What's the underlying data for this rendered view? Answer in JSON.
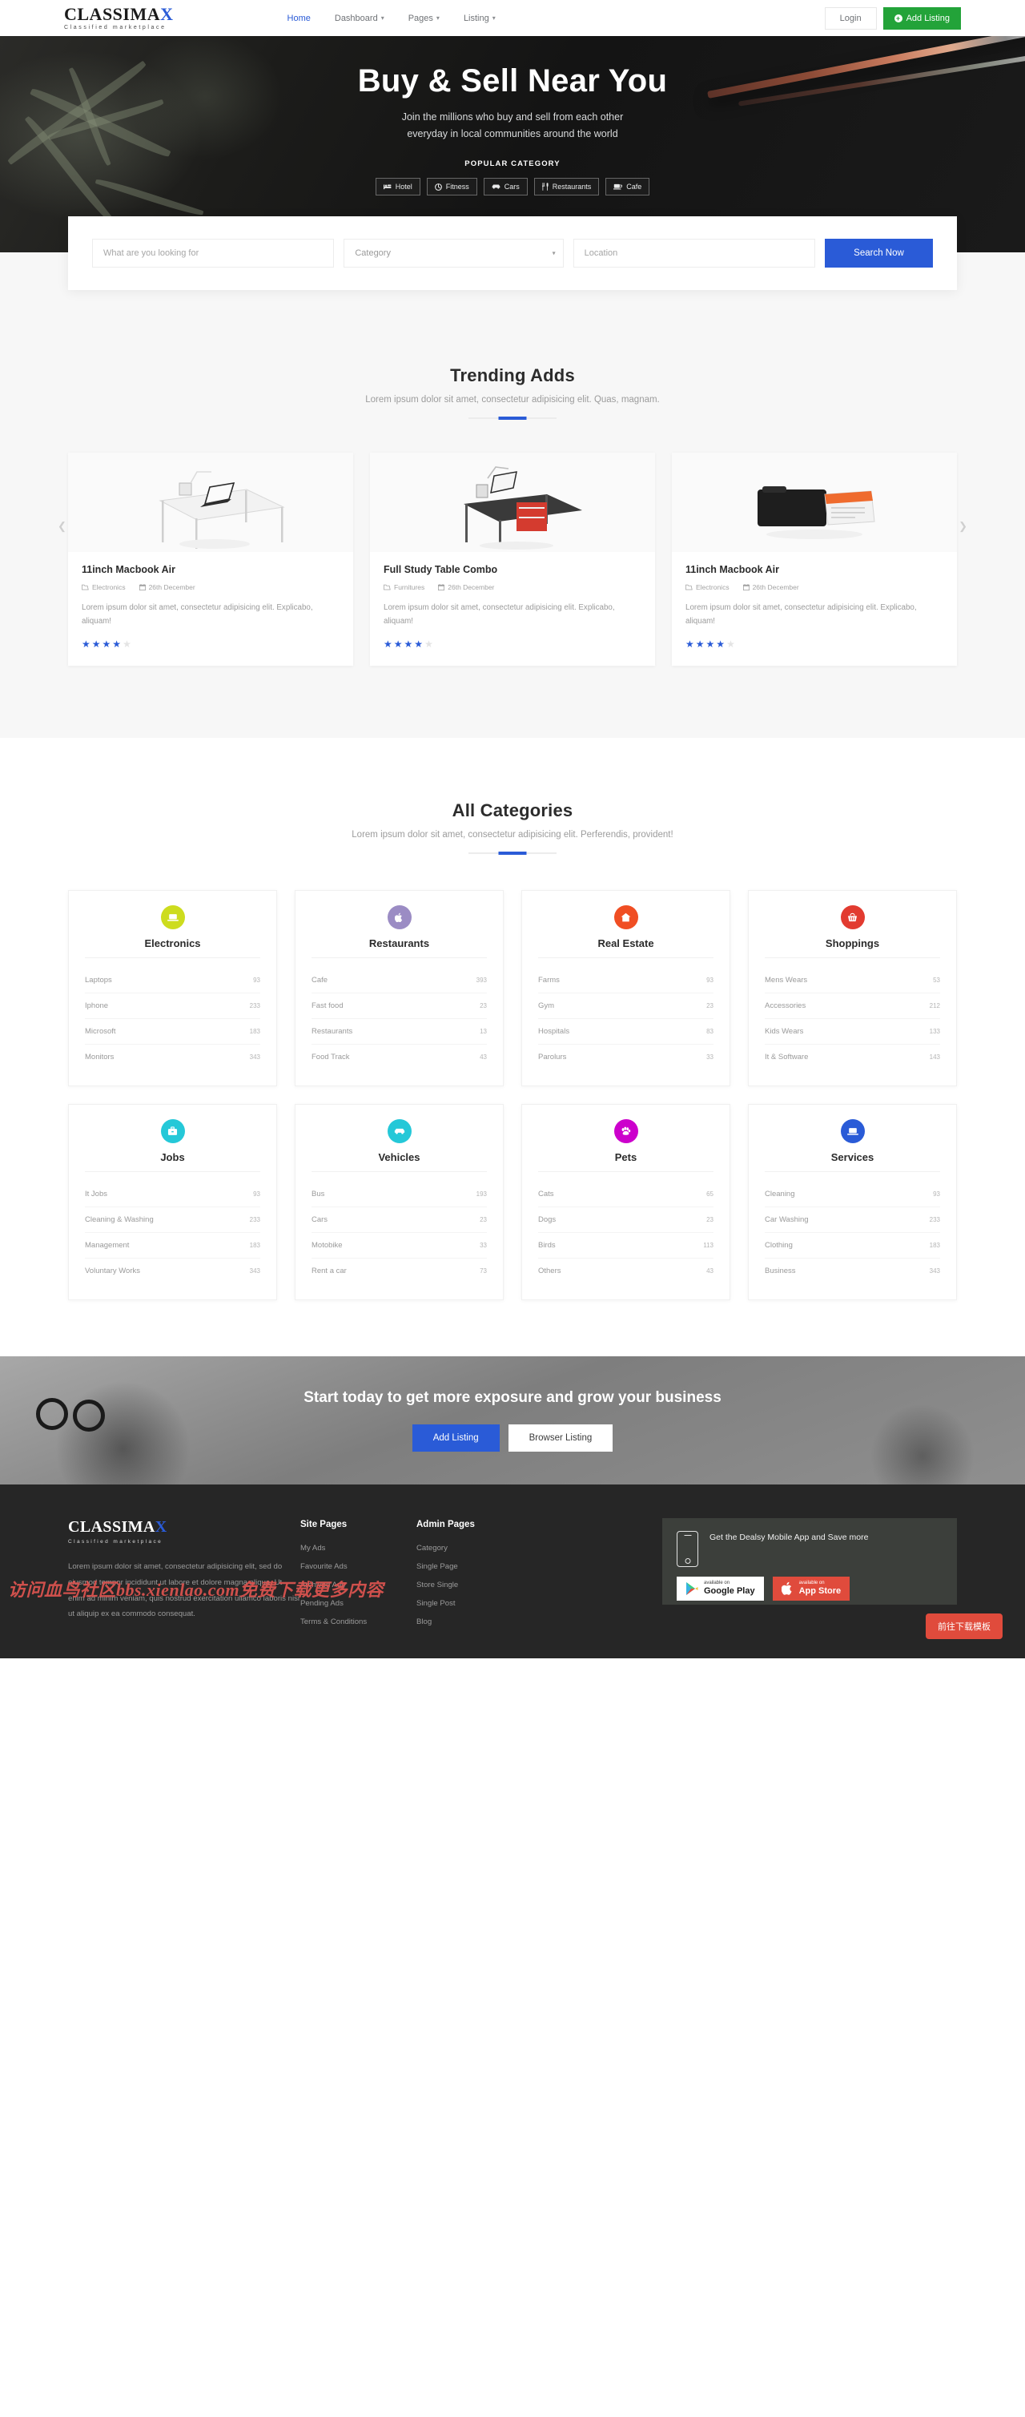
{
  "brand": {
    "name_main": "CLASSIMA",
    "name_accent": "X",
    "tagline": "Classified marketplace"
  },
  "header": {
    "nav": [
      {
        "label": "Home",
        "caret": "",
        "active": true
      },
      {
        "label": "Dashboard",
        "caret": "⌄",
        "active": false
      },
      {
        "label": "Pages",
        "caret": "⌄",
        "active": false
      },
      {
        "label": "Listing",
        "caret": "⌄",
        "active": false
      }
    ],
    "login_label": "Login",
    "add_listing_label": "Add Listing",
    "add_listing_plus": "+"
  },
  "hero": {
    "title": "Buy & Sell Near You",
    "subtitle_line1": "Join the millions who buy and sell from each other",
    "subtitle_line2": "everyday in local communities around the world",
    "popular_label": "POPULAR CATEGORY",
    "chips": [
      {
        "label": "Hotel",
        "icon": "bed-icon"
      },
      {
        "label": "Fitness",
        "icon": "fitness-icon"
      },
      {
        "label": "Cars",
        "icon": "car-icon"
      },
      {
        "label": "Restaurants",
        "icon": "cutlery-icon"
      },
      {
        "label": "Cafe",
        "icon": "coffee-icon"
      }
    ]
  },
  "search": {
    "keyword_placeholder": "What are you looking for",
    "category_value": "Category",
    "location_placeholder": "Location",
    "button_label": "Search Now"
  },
  "trending": {
    "title": "Trending Adds",
    "subtitle": "Lorem ipsum dolor sit amet, consectetur adipisicing elit. Quas, magnam.",
    "cards": [
      {
        "title": "11inch Macbook Air",
        "category": "Electronics",
        "date": "26th December",
        "description": "Lorem ipsum dolor sit amet, consectetur adipisicing elit. Explicabo, aliquam!",
        "rating": 4,
        "image": "desk-with-laptop"
      },
      {
        "title": "Full Study Table Combo",
        "category": "Furnitures",
        "date": "26th December",
        "description": "Lorem ipsum dolor sit amet, consectetur adipisicing elit. Explicabo, aliquam!",
        "rating": 4,
        "image": "study-table-red-drawers"
      },
      {
        "title": "11inch Macbook Air",
        "category": "Electronics",
        "date": "26th December",
        "description": "Lorem ipsum dolor sit amet, consectetur adipisicing elit. Explicabo, aliquam!",
        "rating": 4,
        "image": "black-bag-with-folders"
      }
    ]
  },
  "categories": {
    "title": "All Categories",
    "subtitle": "Lorem ipsum dolor sit amet, consectetur adipisicing elit. Perferendis, provident!",
    "items": [
      {
        "name": "Electronics",
        "icon": "laptop-icon",
        "color": "#cddc1e",
        "rows": [
          {
            "label": "Laptops",
            "count": "93"
          },
          {
            "label": "Iphone",
            "count": "233"
          },
          {
            "label": "Microsoft",
            "count": "183"
          },
          {
            "label": "Monitors",
            "count": "343"
          }
        ]
      },
      {
        "name": "Restaurants",
        "icon": "apple-icon",
        "color": "#9b8cc4",
        "rows": [
          {
            "label": "Cafe",
            "count": "393"
          },
          {
            "label": "Fast food",
            "count": "23"
          },
          {
            "label": "Restaurants",
            "count": "13"
          },
          {
            "label": "Food Track",
            "count": "43"
          }
        ]
      },
      {
        "name": "Real Estate",
        "icon": "home-icon",
        "color": "#f04e23",
        "rows": [
          {
            "label": "Farms",
            "count": "93"
          },
          {
            "label": "Gym",
            "count": "23"
          },
          {
            "label": "Hospitals",
            "count": "83"
          },
          {
            "label": "Parolurs",
            "count": "33"
          }
        ]
      },
      {
        "name": "Shoppings",
        "icon": "basket-icon",
        "color": "#e23b30",
        "rows": [
          {
            "label": "Mens Wears",
            "count": "53"
          },
          {
            "label": "Accessories",
            "count": "212"
          },
          {
            "label": "Kids Wears",
            "count": "133"
          },
          {
            "label": "It & Software",
            "count": "143"
          }
        ]
      },
      {
        "name": "Jobs",
        "icon": "briefcase-icon",
        "color": "#25c8d8",
        "rows": [
          {
            "label": "It Jobs",
            "count": "93"
          },
          {
            "label": "Cleaning & Washing",
            "count": "233"
          },
          {
            "label": "Management",
            "count": "183"
          },
          {
            "label": "Voluntary Works",
            "count": "343"
          }
        ]
      },
      {
        "name": "Vehicles",
        "icon": "car-icon",
        "color": "#25c8d8",
        "rows": [
          {
            "label": "Bus",
            "count": "193"
          },
          {
            "label": "Cars",
            "count": "23"
          },
          {
            "label": "Motobike",
            "count": "33"
          },
          {
            "label": "Rent a car",
            "count": "73"
          }
        ]
      },
      {
        "name": "Pets",
        "icon": "paw-icon",
        "color": "#cc00cc",
        "rows": [
          {
            "label": "Cats",
            "count": "65"
          },
          {
            "label": "Dogs",
            "count": "23"
          },
          {
            "label": "Birds",
            "count": "113"
          },
          {
            "label": "Others",
            "count": "43"
          }
        ]
      },
      {
        "name": "Services",
        "icon": "laptop-icon",
        "color": "#2a5bd7",
        "rows": [
          {
            "label": "Cleaning",
            "count": "93"
          },
          {
            "label": "Car Washing",
            "count": "233"
          },
          {
            "label": "Clothing",
            "count": "183"
          },
          {
            "label": "Business",
            "count": "343"
          }
        ]
      }
    ]
  },
  "cta": {
    "title": "Start today to get more exposure and grow your business",
    "primary_label": "Add Listing",
    "secondary_label": "Browser Listing"
  },
  "footer": {
    "about_text": "Lorem ipsum dolor sit amet, consectetur adipisicing elit, sed do eiusmod tempor incididunt ut labore et dolore magna aliqua. Ut enim ad minim veniam, quis nostrud exercitation ullamco laboris nisi ut aliquip ex ea commodo consequat.",
    "site_pages_head": "Site Pages",
    "site_pages": [
      "My Ads",
      "Favourite Ads",
      "Archived Ads",
      "Pending Ads",
      "Terms & Conditions"
    ],
    "admin_pages_head": "Admin Pages",
    "admin_pages": [
      "Category",
      "Single Page",
      "Store Single",
      "Single Post",
      "Blog"
    ],
    "app_text": "Get the Dealsy Mobile App and Save more",
    "google_small": "available on",
    "google_big": "Google Play",
    "apple_small": "available on",
    "apple_big": "App Store",
    "watermark": "访问血鸟社区bbs.xienlao.com免费下载更多内容",
    "float_button": "前往下载模板"
  }
}
